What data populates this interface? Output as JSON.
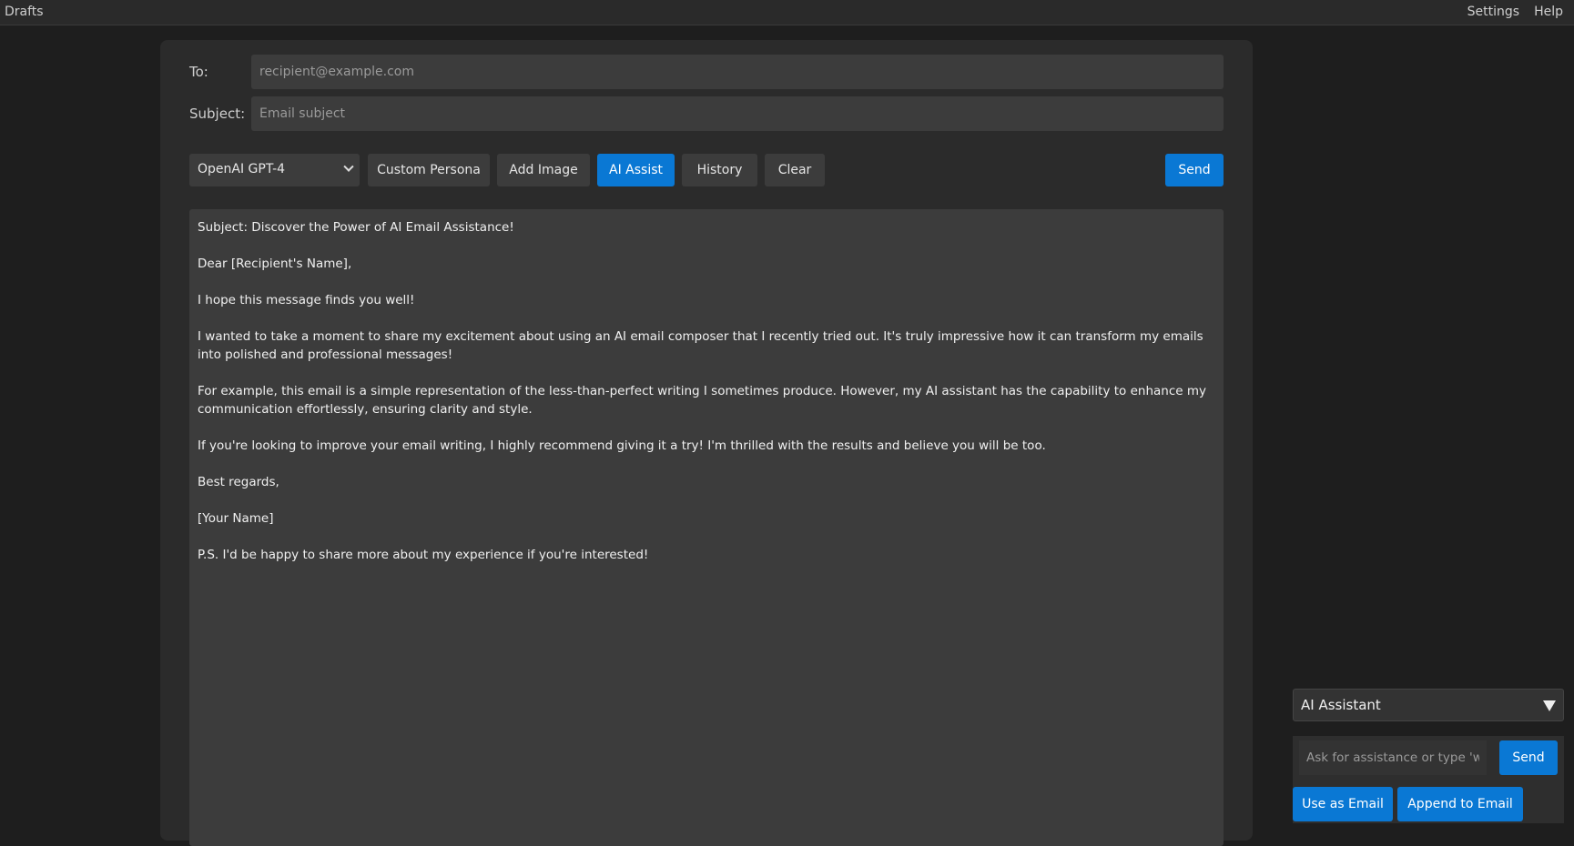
{
  "topbar": {
    "drafts": "Drafts",
    "settings": "Settings",
    "help": "Help"
  },
  "composer": {
    "to_label": "To:",
    "to_placeholder": "recipient@example.com",
    "subject_label": "Subject:",
    "subject_placeholder": "Email subject"
  },
  "toolbar": {
    "model_selected": "OpenAI GPT-4",
    "custom_persona": "Custom Persona",
    "add_image": "Add Image",
    "ai_assist": "AI Assist",
    "history": "History",
    "clear": "Clear",
    "send": "Send"
  },
  "body": {
    "paragraphs": [
      "Subject: Discover the Power of AI Email Assistance!",
      "Dear [Recipient's Name],",
      "I hope this message finds you well!",
      "I wanted to take a moment to share my excitement about using an AI email composer that I recently tried out. It's truly impressive how it can transform my emails into polished and professional messages!",
      "For example, this email is a simple representation of the less-than-perfect writing I sometimes produce. However, my AI assistant has the capability to enhance my communication effortlessly, ensuring clarity and style.",
      "If you're looking to improve your email writing, I highly recommend giving it a try! I'm thrilled with the results and believe you will be too.",
      "Best regards,",
      "[Your Name]",
      "P.S. I'd be happy to share more about my experience if you're interested!"
    ]
  },
  "assistant": {
    "title": "AI Assistant",
    "toggle_icon": "triangle-down-icon",
    "input_placeholder": "Ask for assistance or type 'write ...'",
    "send": "Send",
    "use_as_email": "Use as Email",
    "append_to_email": "Append to Email"
  },
  "colors": {
    "background": "#1e1e1e",
    "panel": "#2b2b2b",
    "field": "#3c3c3c",
    "accent": "#0a78d4"
  }
}
